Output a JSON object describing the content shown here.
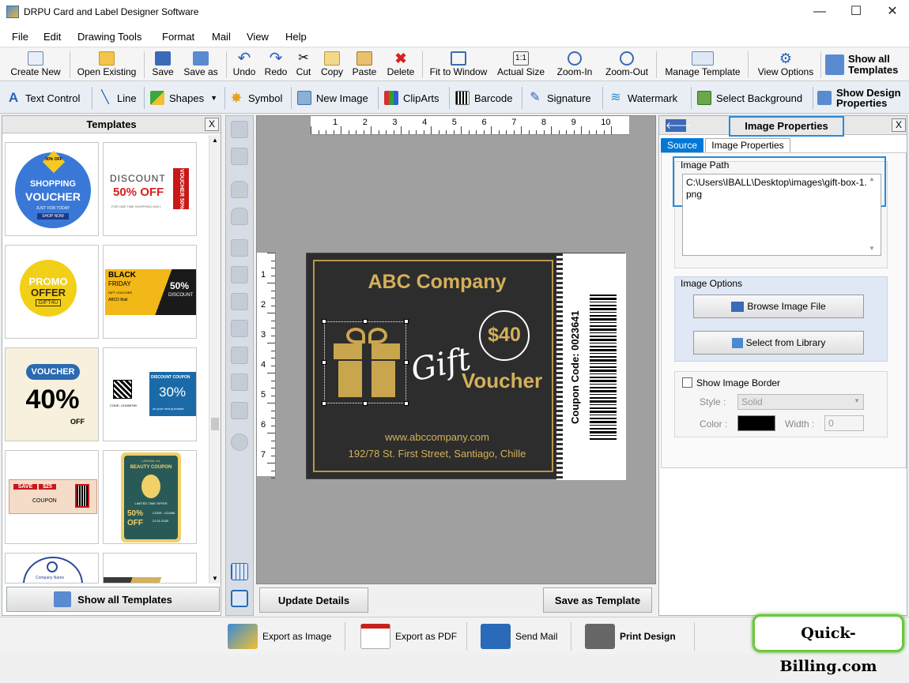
{
  "window": {
    "title": "DRPU Card and Label Designer Software",
    "min": "—",
    "max": "☐",
    "close": "✕"
  },
  "menu": [
    "File",
    "Edit",
    "Drawing Tools",
    "Format",
    "Mail",
    "View",
    "Help"
  ],
  "toolbar1": {
    "create_new": "Create New",
    "open_existing": "Open Existing",
    "save": "Save",
    "save_as": "Save as",
    "undo": "Undo",
    "redo": "Redo",
    "cut": "Cut",
    "copy": "Copy",
    "paste": "Paste",
    "delete": "Delete",
    "fit_to_window": "Fit to Window",
    "actual_size": "Actual Size",
    "zoom_in": "Zoom-In",
    "zoom_out": "Zoom-Out",
    "manage_template": "Manage Template",
    "view_options": "View Options",
    "show_all_templates": "Show all Templates"
  },
  "toolbar2": {
    "text_control": "Text Control",
    "line": "Line",
    "shapes": "Shapes",
    "symbol": "Symbol",
    "new_image": "New Image",
    "cliparts": "ClipArts",
    "barcode": "Barcode",
    "signature": "Signature",
    "watermark": "Watermark",
    "select_background": "Select Background",
    "show_design_properties": "Show Design Properties"
  },
  "templates_panel": {
    "title": "Templates",
    "close": "X",
    "show_all": "Show all Templates",
    "t1": {
      "badge": "30% OFF",
      "line1": "SHOPPING",
      "line2": "VOUCHER",
      "line3": "JUST FOR TODAY",
      "btn": "SHOP NOW"
    },
    "t2": {
      "line1": "DISCOUNT",
      "line2": "50% OFF",
      "side": "VOUCHER 50% OFF",
      "small": "FOR ONE TIME SHOPPING ONLY"
    },
    "t3": {
      "line1": "PROMO",
      "line2": "OFFER",
      "tag": "GIFT4U"
    },
    "t4": {
      "line1": "BLACK",
      "line2": "FRIDAY",
      "line3": "GIFT VOUCHER",
      "line4": "ABCD Mall",
      "pct": "50%",
      "disc": "DISCOUNT"
    },
    "t5": {
      "badge": "VOUCHER",
      "pct": "40%",
      "off": "OFF"
    },
    "t6": {
      "title": "DISCOUNT COUPON",
      "pct": "30%",
      "code": "CODE: 123456789",
      "sub": "on your next purchase"
    },
    "t7": {
      "save": "SAVE",
      "amt": "$25",
      "coupon": "COUPON"
    },
    "t8": {
      "brand": "LARANA, Inc",
      "title": "BEAUTY COUPON",
      "offer": "LIMITED TIME OFFER",
      "pct": "50%",
      "off": "OFF",
      "code": "CODE : 123456",
      "date": "21.01.2030"
    },
    "t9": {
      "name": "Company Name"
    }
  },
  "ruler": {
    "h": [
      "1",
      "2",
      "3",
      "4",
      "5",
      "6",
      "7",
      "8",
      "9",
      "10"
    ],
    "v": [
      "1",
      "2",
      "3",
      "4",
      "5",
      "6",
      "7"
    ]
  },
  "card": {
    "company": "ABC Company",
    "price": "$40",
    "gift": "Gift",
    "voucher": "Voucher",
    "website": "www.abccompany.com",
    "address": "192/78 St. First Street, Santiago, Chille",
    "coupon_code": "Coupon Code: 0023641"
  },
  "canvas_buttons": {
    "update": "Update Details",
    "save_template": "Save as Template"
  },
  "right_panel": {
    "back": "🡐",
    "title": "Image Properties",
    "close": "X",
    "tab_source": "Source",
    "tab_props": "Image Properties",
    "image_path_label": "Image Path",
    "image_path": "C:\\Users\\IBALL\\Desktop\\images\\gift-box-1.png",
    "image_options_label": "Image Options",
    "browse": "Browse Image File",
    "library": "Select from Library",
    "show_border": "Show Image Border",
    "style_label": "Style :",
    "style_value": "Solid",
    "color_label": "Color :",
    "width_label": "Width :",
    "width_value": "0",
    "border_color": "#000000"
  },
  "statusbar": {
    "export_image": "Export as Image",
    "export_pdf": "Export as PDF",
    "send_mail": "Send Mail",
    "print_design": "Print Design",
    "brand": "Quick-Billing.com"
  },
  "colors": {
    "accent": "#0078d7",
    "gold": "#d4b05a",
    "card_bg": "#2d2d2d",
    "brand_green": "#6ac93c"
  }
}
